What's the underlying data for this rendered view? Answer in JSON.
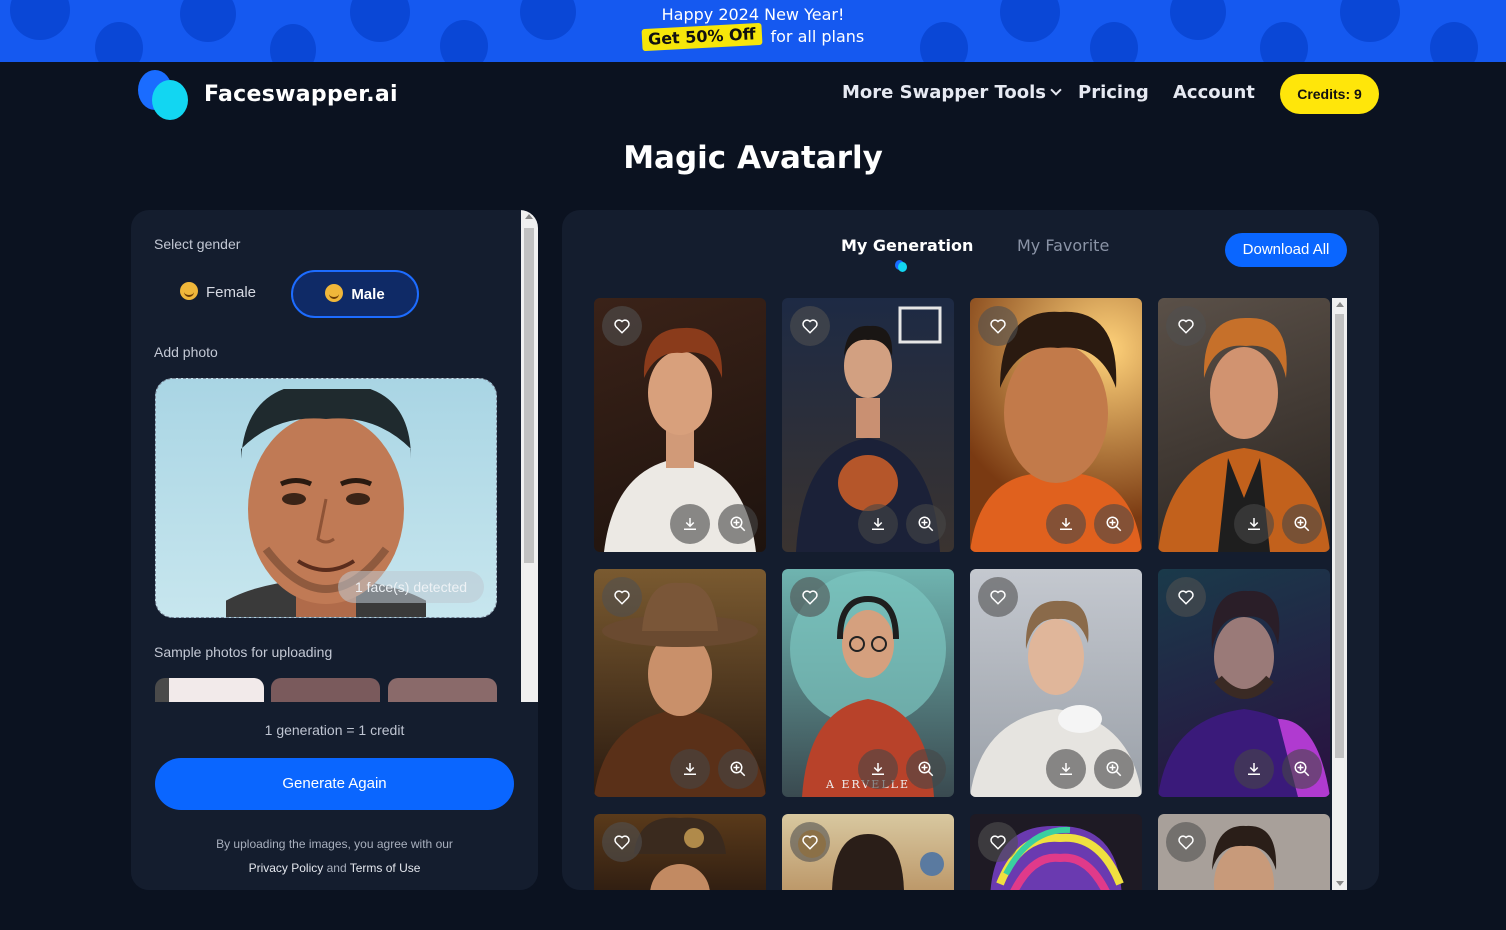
{
  "promo": {
    "line1": "Happy 2024 New Year!",
    "offer": "Get 50% Off",
    "line2_rest": "for all plans"
  },
  "header": {
    "brand": "Faceswapper.ai",
    "nav": {
      "tools": "More Swapper Tools",
      "pricing": "Pricing",
      "account": "Account"
    },
    "credits": "Credits: 9"
  },
  "page_title": "Magic Avatarly",
  "left": {
    "gender_label": "Select gender",
    "female": "Female",
    "male": "Male",
    "add_photo_label": "Add photo",
    "face_badge": "1 face(s) detected",
    "samples_label": "Sample photos for uploading",
    "gen_cost": "1 generation = 1 credit",
    "generate_button": "Generate Again",
    "terms_prefix": "By uploading the images, you agree with our",
    "privacy": "Privacy Policy",
    "and": "and",
    "terms": "Terms of Use"
  },
  "right": {
    "tab_generation": "My Generation",
    "tab_favorite": "My Favorite",
    "download_all": "Download All",
    "caption_card6": "A ERVELLE"
  },
  "colors": {
    "accent": "#0a66ff",
    "credits_bg": "#ffe60a",
    "panel": "#141d2e",
    "page_bg": "#0b1220"
  },
  "icons": {
    "favorite": "heart-icon",
    "download": "download-icon",
    "zoom": "zoom-in-icon",
    "dropdown": "chevron-down-icon"
  }
}
